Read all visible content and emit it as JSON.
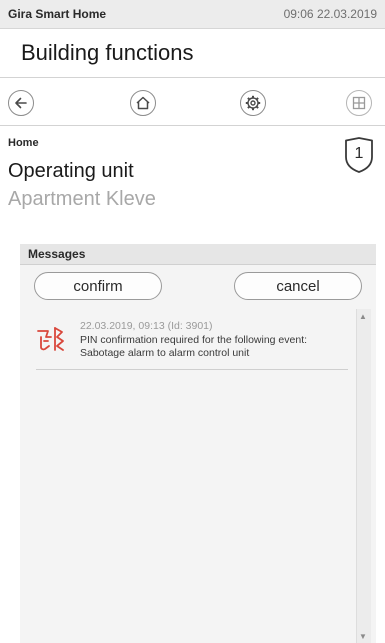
{
  "status": {
    "app_name": "Gira Smart Home",
    "datetime": "09:06 22.03.2019"
  },
  "header": {
    "title": "Building functions"
  },
  "toolbar": {
    "buttons": [
      "back-icon",
      "home-icon",
      "settings-icon",
      "grid-icon"
    ]
  },
  "breadcrumb": "Home",
  "unit": {
    "title": "Operating unit",
    "subtitle": "Apartment Kleve",
    "badge_number": "1"
  },
  "messages": {
    "section_label": "Messages",
    "confirm_label": "confirm",
    "cancel_label": "cancel",
    "items": [
      {
        "icon": "sabotage-alarm-icon",
        "meta": "22.03.2019, 09:13 (Id: 3901)",
        "text": "PIN confirmation required for the following event: Sabotage alarm to alarm control unit"
      }
    ]
  },
  "colors": {
    "alarm_icon": "#d9473b",
    "muted_text": "#a8a8a8",
    "panel_bg": "#f4f4f4"
  }
}
